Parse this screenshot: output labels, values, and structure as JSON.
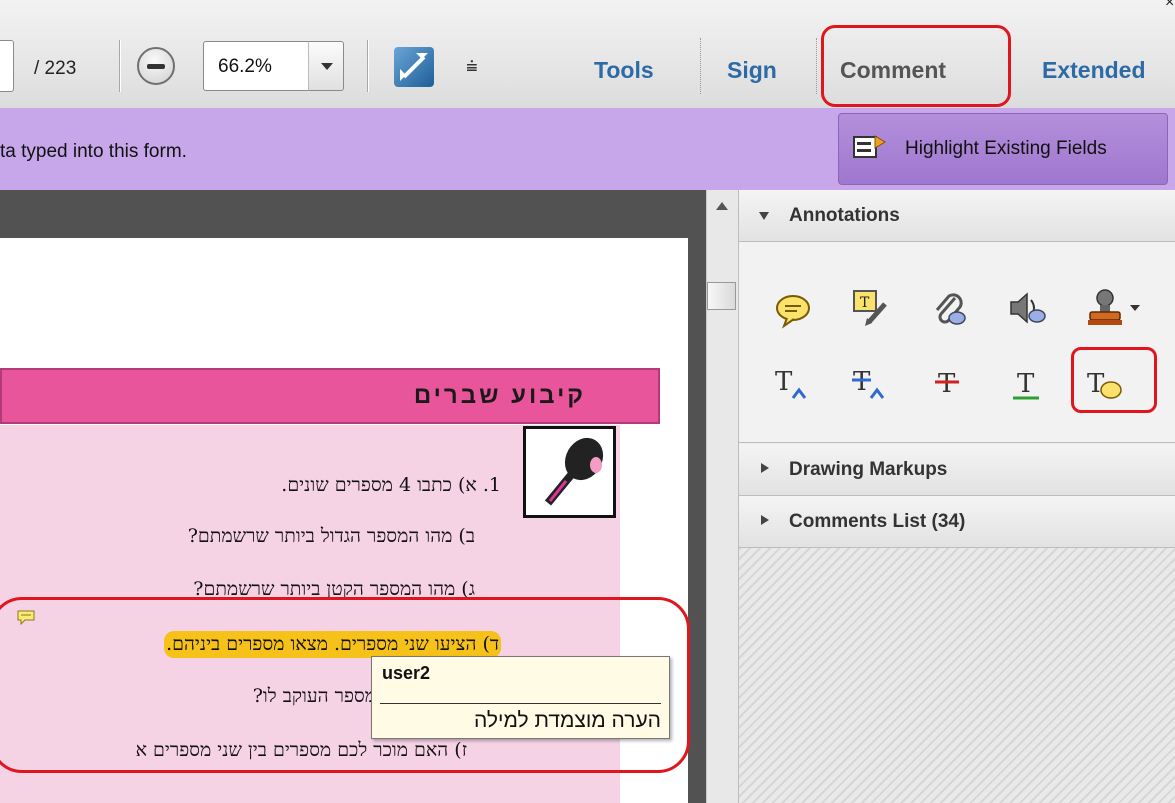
{
  "toolbar": {
    "page_total": "/ 223",
    "zoom_value": "66.2%",
    "tools_label": "Tools",
    "sign_label": "Sign",
    "comment_label": "Comment",
    "extended_label": "Extended"
  },
  "formbar": {
    "message": "ta typed into this form.",
    "highlight_label": "Highlight Existing Fields"
  },
  "document": {
    "title": "קיבוע שברים",
    "lines": [
      "1. א) כתבו 4 מספרים שונים.",
      "ב) מהו המספר הגדול ביותר שרשמתם?",
      "ג) מהו המספר הקטן ביותר שרשמתם?",
      "ד) הציעו שני מספרים. מצאו מספרים ביניהם.",
      "מספר העוקב לו?",
      "ז) האם מוכר לכם מספרים בין שני מספרים א"
    ]
  },
  "tooltip": {
    "author": "user2",
    "text": "הערה מוצמדת למילה"
  },
  "pane": {
    "annotations_label": "Annotations",
    "drawing_label": "Drawing Markups",
    "comments_label": "Comments List (34)"
  },
  "colors": {
    "link_blue": "#2d6aa6",
    "form_bar": "#c7a7ea",
    "highlight_yellow": "#f6c118",
    "title_pink": "#e9559a",
    "annotation_red": "#e0161e"
  },
  "icons": [
    "sticky-note-icon",
    "text-callout-icon",
    "attach-file-icon",
    "record-audio-icon",
    "stamp-icon",
    "insert-text-icon",
    "replace-text-icon",
    "strikethrough-icon",
    "underline-icon",
    "add-note-to-text-icon"
  ]
}
